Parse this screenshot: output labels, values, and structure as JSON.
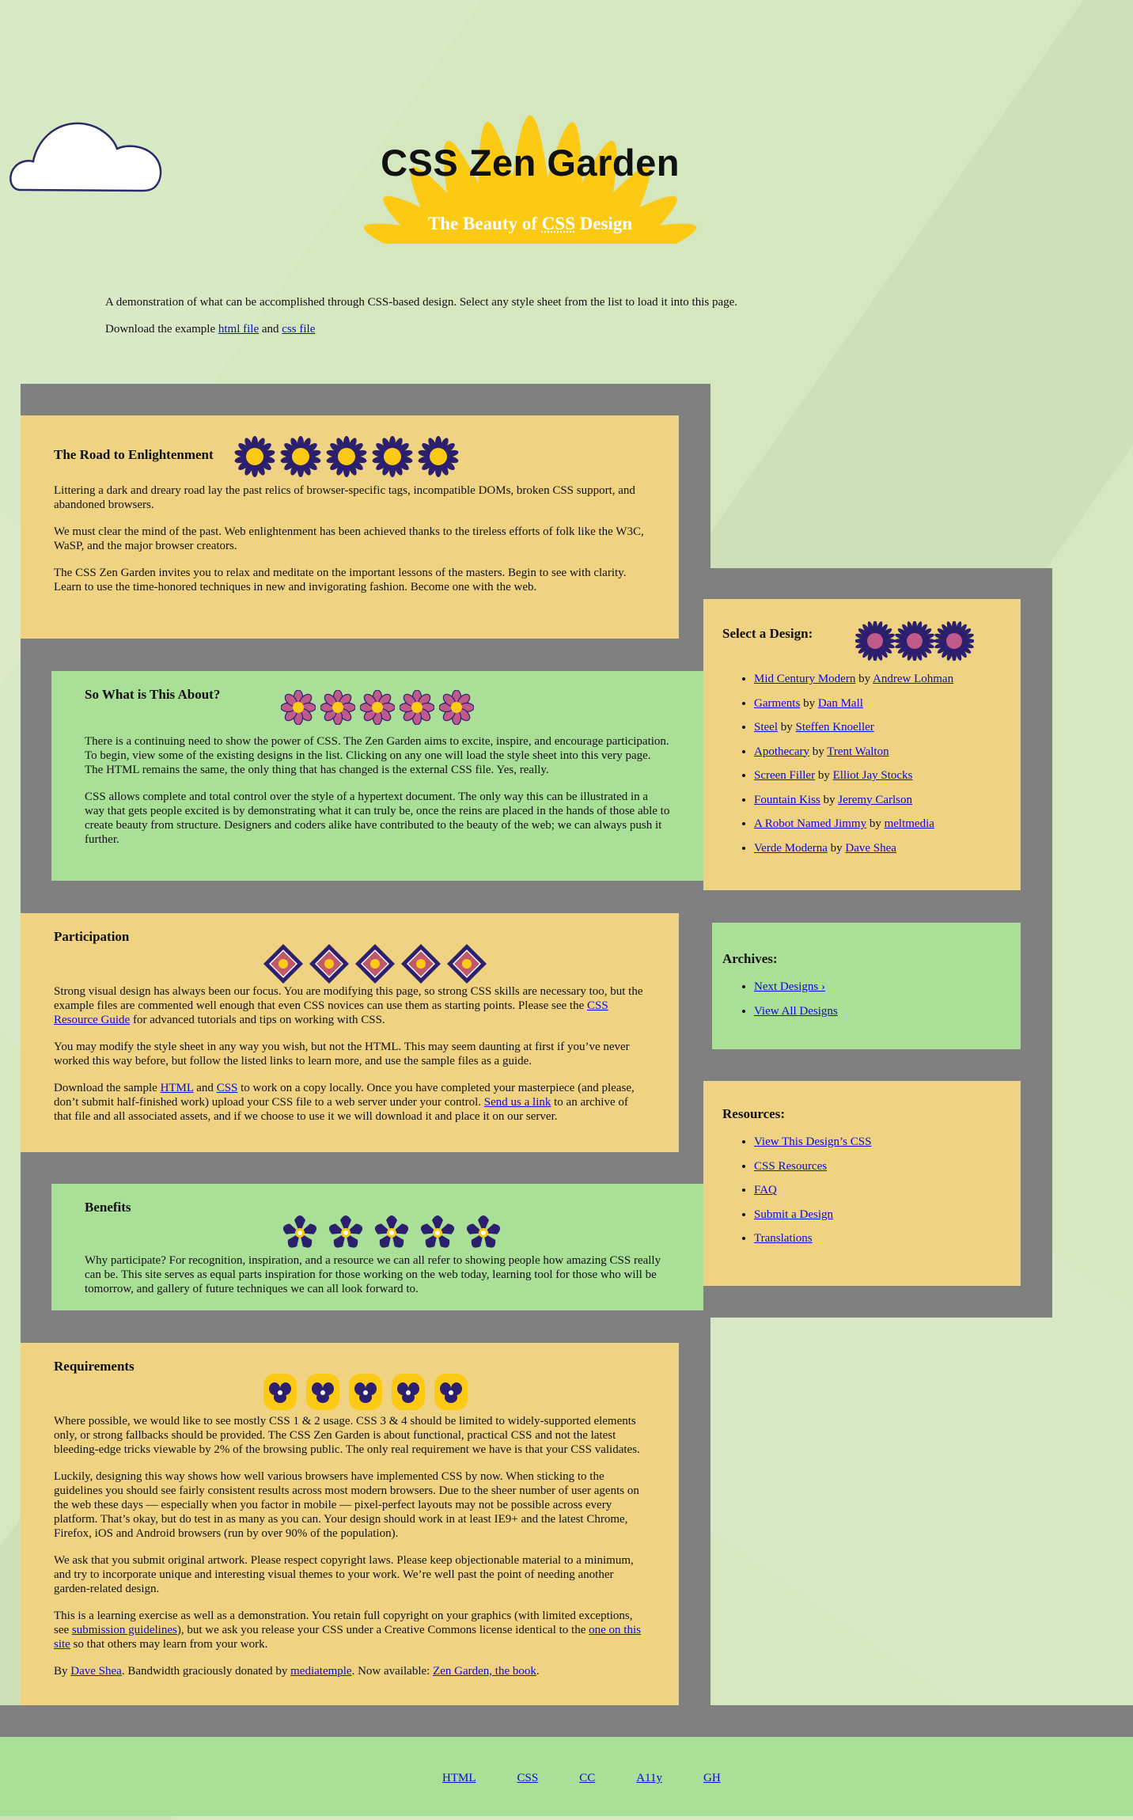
{
  "header": {
    "title": "CSS Zen Garden",
    "subtitle_prefix": "The Beauty of ",
    "subtitle_abbr": "CSS",
    "subtitle_suffix": " Design"
  },
  "intro": {
    "summary": "A demonstration of what can be accomplished through CSS-based design. Select any style sheet from the list to load it into this page.",
    "download_prefix": "Download the example ",
    "html_link": "html file",
    "and": " and ",
    "css_link": "css file"
  },
  "sections": {
    "road": {
      "heading": "The Road to Enlightenment",
      "p1": "Littering a dark and dreary road lay the past relics of browser-specific tags, incompatible DOMs, broken CSS support, and abandoned browsers.",
      "p2": "We must clear the mind of the past. Web enlightenment has been achieved thanks to the tireless efforts of folk like the W3C, WaSP, and the major browser creators.",
      "p3": "The CSS Zen Garden invites you to relax and meditate on the important lessons of the masters. Begin to see with clarity. Learn to use the time-honored techniques in new and invigorating fashion. Become one with the web."
    },
    "about": {
      "heading": "So What is This About?",
      "p1": "There is a continuing need to show the power of CSS. The Zen Garden aims to excite, inspire, and encourage participation. To begin, view some of the existing designs in the list. Clicking on any one will load the style sheet into this very page. The HTML remains the same, the only thing that has changed is the external CSS file. Yes, really.",
      "p2": "CSS allows complete and total control over the style of a hypertext document. The only way this can be illustrated in a way that gets people excited is by demonstrating what it can truly be, once the reins are placed in the hands of those able to create beauty from structure. Designers and coders alike have contributed to the beauty of the web; we can always push it further."
    },
    "participation": {
      "heading": "Participation",
      "p1_a": "Strong visual design has always been our focus. You are modifying this page, so strong CSS skills are necessary too, but the example files are commented well enough that even CSS novices can use them as starting points. Please see the ",
      "p1_link": "CSS Resource Guide",
      "p1_b": " for advanced tutorials and tips on working with CSS.",
      "p2": "You may modify the style sheet in any way you wish, but not the HTML. This may seem daunting at first if you’ve never worked this way before, but follow the listed links to learn more, and use the sample files as a guide.",
      "p3_a": "Download the sample ",
      "p3_link_html": "HTML",
      "p3_and": " and ",
      "p3_link_css": "CSS",
      "p3_b": " to work on a copy locally. Once you have completed your masterpiece (and please, don’t submit half-finished work) upload your CSS file to a web server under your control. ",
      "p3_link_send": "Send us a link",
      "p3_c": " to an archive of that file and all associated assets, and if we choose to use it we will download it and place it on our server."
    },
    "benefits": {
      "heading": "Benefits",
      "p1": "Why participate? For recognition, inspiration, and a resource we can all refer to showing people how amazing CSS really can be. This site serves as equal parts inspiration for those working on the web today, learning tool for those who will be tomorrow, and gallery of future techniques we can all look forward to."
    },
    "requirements": {
      "heading": "Requirements",
      "p1": "Where possible, we would like to see mostly CSS 1 & 2 usage. CSS 3 & 4 should be limited to widely-supported elements only, or strong fallbacks should be provided. The CSS Zen Garden is about functional, practical CSS and not the latest bleeding-edge tricks viewable by 2% of the browsing public. The only real requirement we have is that your CSS validates.",
      "p2": "Luckily, designing this way shows how well various browsers have implemented CSS by now. When sticking to the guidelines you should see fairly consistent results across most modern browsers. Due to the sheer number of user agents on the web these days — especially when you factor in mobile — pixel-perfect layouts may not be possible across every platform. That’s okay, but do test in as many as you can. Your design should work in at least IE9+ and the latest Chrome, Firefox, iOS and Android browsers (run by over 90% of the population).",
      "p3": "We ask that you submit original artwork. Please respect copyright laws. Please keep objectionable material to a minimum, and try to incorporate unique and interesting visual themes to your work. We’re well past the point of needing another garden-related design.",
      "p4_a": "This is a learning exercise as well as a demonstration. You retain full copyright on your graphics (with limited exceptions, see ",
      "p4_link1": "submission guidelines",
      "p4_b": "), but we ask you release your CSS under a Creative Commons license identical to the ",
      "p4_link2": "one on this site",
      "p4_c": " so that others may learn from your work.",
      "p5_a": "By ",
      "p5_link1": "Dave Shea",
      "p5_b": ". Bandwidth graciously donated by ",
      "p5_link2": "mediatemple",
      "p5_c": ". Now available: ",
      "p5_link3": "Zen Garden, the book",
      "p5_d": "."
    }
  },
  "sidebar": {
    "designs": {
      "heading": "Select a Design:",
      "by": " by ",
      "items": [
        {
          "name": "Mid Century Modern",
          "author": "Andrew Lohman"
        },
        {
          "name": "Garments",
          "author": "Dan Mall"
        },
        {
          "name": "Steel",
          "author": "Steffen Knoeller"
        },
        {
          "name": "Apothecary",
          "author": "Trent Walton"
        },
        {
          "name": "Screen Filler",
          "author": "Elliot Jay Stocks"
        },
        {
          "name": "Fountain Kiss",
          "author": "Jeremy Carlson"
        },
        {
          "name": "A Robot Named Jimmy",
          "author": "meltmedia"
        },
        {
          "name": "Verde Moderna",
          "author": "Dave Shea"
        }
      ]
    },
    "archives": {
      "heading": "Archives:",
      "items": [
        "Next Designs ›",
        "View All Designs"
      ]
    },
    "resources": {
      "heading": "Resources:",
      "items": [
        "View This Design’s CSS",
        "CSS Resources",
        "FAQ",
        "Submit a Design",
        "Translations"
      ]
    }
  },
  "footer": {
    "links": [
      "HTML",
      "CSS",
      "CC",
      "A11y",
      "GH"
    ]
  },
  "colors": {
    "background": "#d4e7bf",
    "panel_gray": "#808080",
    "yellow_section": "#efd383",
    "green_section": "#a9df96",
    "sun": "#fcca14",
    "link": "#0b0bd6",
    "flower_purple": "#2c1f6e"
  },
  "icons": {
    "header": [
      "cloud-icon",
      "sun-icon"
    ],
    "road": "sunflower-icon",
    "about": "pink-flower-icon",
    "participation": "diamond-flower-icon",
    "benefits": "violet-flower-icon",
    "requirements": "pansy-icon",
    "designs": "aster-icon"
  }
}
